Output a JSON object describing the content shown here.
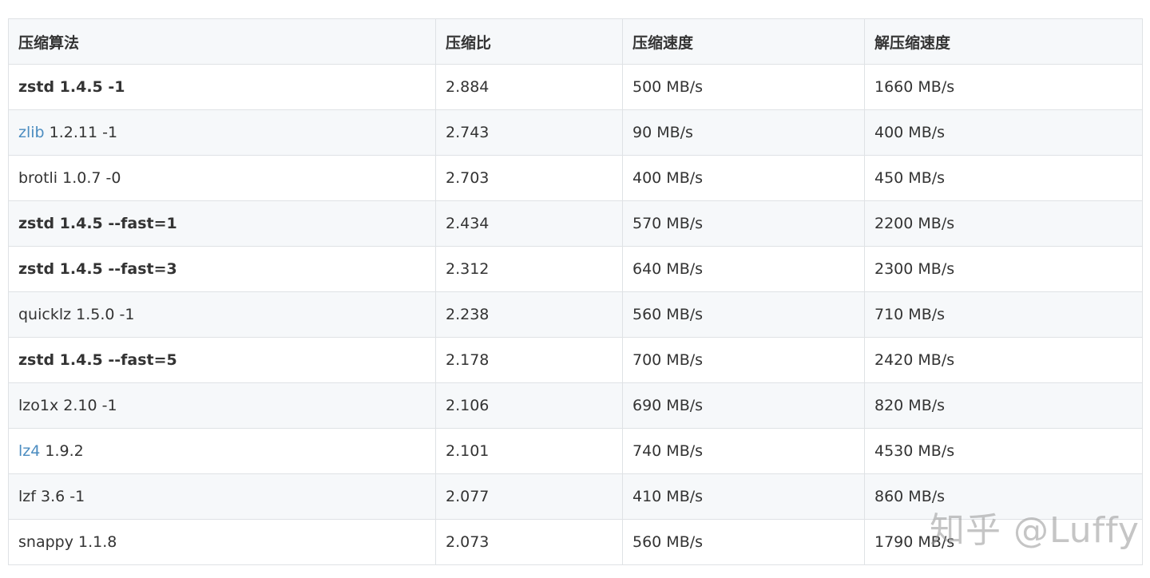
{
  "table": {
    "headers": [
      "压缩算法",
      "压缩比",
      "压缩速度",
      "解压缩速度"
    ],
    "rows": [
      {
        "algo_link": "",
        "algo": "zstd 1.4.5 -1",
        "bold": true,
        "ratio": "2.884",
        "comp": "500 MB/s",
        "decomp": "1660 MB/s"
      },
      {
        "algo_link": "zlib",
        "algo": " 1.2.11 -1",
        "bold": false,
        "ratio": "2.743",
        "comp": "90 MB/s",
        "decomp": "400 MB/s"
      },
      {
        "algo_link": "",
        "algo": "brotli 1.0.7 -0",
        "bold": false,
        "ratio": "2.703",
        "comp": "400 MB/s",
        "decomp": "450 MB/s"
      },
      {
        "algo_link": "",
        "algo": "zstd 1.4.5 --fast=1",
        "bold": true,
        "ratio": "2.434",
        "comp": "570 MB/s",
        "decomp": "2200 MB/s"
      },
      {
        "algo_link": "",
        "algo": "zstd 1.4.5 --fast=3",
        "bold": true,
        "ratio": "2.312",
        "comp": "640 MB/s",
        "decomp": "2300 MB/s"
      },
      {
        "algo_link": "",
        "algo": "quicklz 1.5.0 -1",
        "bold": false,
        "ratio": "2.238",
        "comp": "560 MB/s",
        "decomp": "710 MB/s"
      },
      {
        "algo_link": "",
        "algo": "zstd 1.4.5 --fast=5",
        "bold": true,
        "ratio": "2.178",
        "comp": "700 MB/s",
        "decomp": "2420 MB/s"
      },
      {
        "algo_link": "",
        "algo": "lzo1x 2.10 -1",
        "bold": false,
        "ratio": "2.106",
        "comp": "690 MB/s",
        "decomp": "820 MB/s"
      },
      {
        "algo_link": "lz4",
        "algo": " 1.9.2",
        "bold": false,
        "ratio": "2.101",
        "comp": "740 MB/s",
        "decomp": "4530 MB/s"
      },
      {
        "algo_link": "",
        "algo": "lzf 3.6 -1",
        "bold": false,
        "ratio": "2.077",
        "comp": "410 MB/s",
        "decomp": "860 MB/s"
      },
      {
        "algo_link": "",
        "algo": "snappy 1.1.8",
        "bold": false,
        "ratio": "2.073",
        "comp": "560 MB/s",
        "decomp": "1790 MB/s"
      }
    ]
  },
  "watermark": "知乎 @Luffy",
  "colors": {
    "link": "#4b8cc0",
    "border": "#dfe2e5",
    "stripe": "#f6f8fa",
    "text": "#333333"
  }
}
